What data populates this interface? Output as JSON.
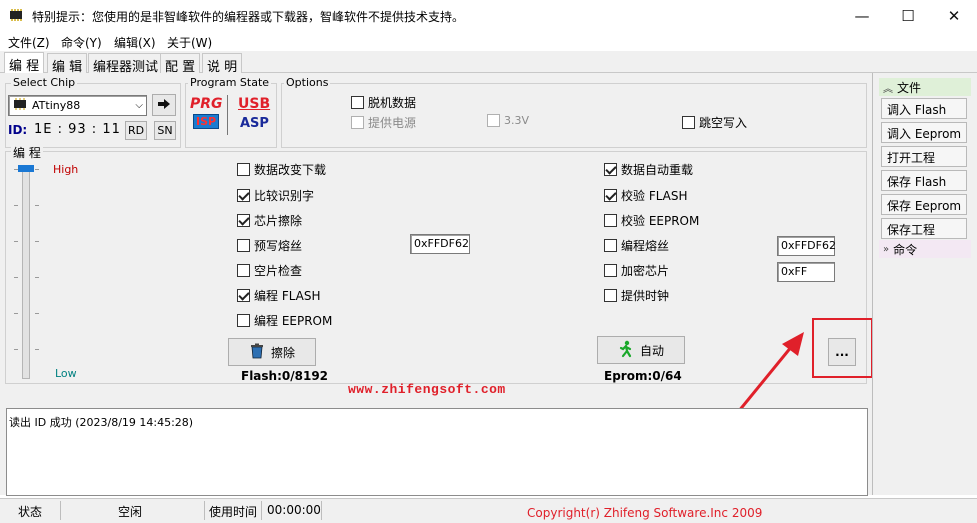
{
  "window": {
    "title": "特别提示：您使用的是非智峰软件的编程器或下载器，智峰软件不提供技术支持。",
    "minimize_glyph": "—",
    "maximize_glyph": "☐",
    "close_glyph": "✕"
  },
  "menu": [
    "文件(Z)",
    "命令(Y)",
    "编辑(X)",
    "关于(W)"
  ],
  "tabs": [
    "编 程",
    "编 辑",
    "编程器测试",
    "配 置",
    "说 明"
  ],
  "select_chip": {
    "label": "Select Chip",
    "chip": "ATtiny88",
    "id_label": "ID:",
    "id_value": "1E : 93 : 11",
    "rd": "RD",
    "sn": "SN"
  },
  "program_state": {
    "label": "Program State",
    "prg": "PRG",
    "isp": "ISP",
    "usb": "USB",
    "asp": "ASP"
  },
  "options": {
    "label": "Options",
    "offline": "脱机数据",
    "power": "提供电源",
    "voltage": "3.3V",
    "skip_empty": "跳空写入"
  },
  "program_group": {
    "label": "编 程",
    "high": "High",
    "low": "Low",
    "left_checks": [
      {
        "label": "数据改变下载",
        "checked": false
      },
      {
        "label": "比较识别字",
        "checked": true
      },
      {
        "label": "芯片擦除",
        "checked": true
      },
      {
        "label": "预写熔丝",
        "checked": false
      },
      {
        "label": "空片检查",
        "checked": false
      },
      {
        "label": "编程 FLASH",
        "checked": true
      },
      {
        "label": "编程 EEPROM",
        "checked": false
      }
    ],
    "right_checks": [
      {
        "label": "数据自动重载",
        "checked": true
      },
      {
        "label": "校验 FLASH",
        "checked": true
      },
      {
        "label": "校验 EEPROM",
        "checked": false
      },
      {
        "label": "编程熔丝",
        "checked": false
      },
      {
        "label": "加密芯片",
        "checked": false
      },
      {
        "label": "提供时钟",
        "checked": false
      }
    ],
    "prewrite_fuse_value": "0xFFDF62",
    "program_fuse_value": "0xFFDF62",
    "lock_value": "0xFF",
    "erase_button": "擦除",
    "auto_button": "自动",
    "more_button": "...",
    "flash_info": "Flash:0/8192",
    "eprom_info": "Eprom:0/64"
  },
  "website": "www.zhifengsoft.com",
  "log": [
    "读出 ID 成功 (2023/8/19 14:45:28)"
  ],
  "status": {
    "state_label": "状态",
    "state_value": "空闲",
    "time_label": "使用时间",
    "time_value": "00:00:00",
    "copyright": "Copyright(r) Zhifeng Software.Inc 2009"
  },
  "right_panel": {
    "file_header": "文件",
    "buttons": [
      "调入 Flash",
      "调入 Eeprom",
      "打开工程",
      "保存 Flash",
      "保存 Eeprom",
      "保存工程"
    ],
    "command_header": "命令"
  },
  "colors": {
    "accent_red": "#e0202a",
    "high_color": "#c00000",
    "low_color": "#008080",
    "id_blue": "#00008b"
  }
}
